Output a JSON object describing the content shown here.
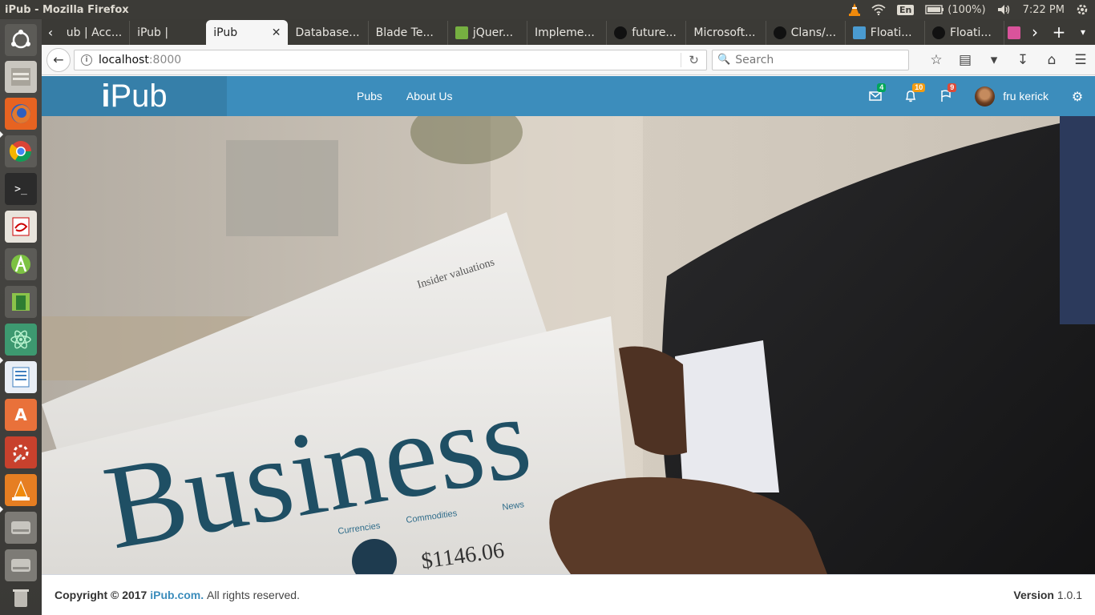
{
  "os": {
    "window_title": "iPub - Mozilla Firefox",
    "battery": "(100%)",
    "clock": "7:22 PM",
    "keyboard_layout": "En"
  },
  "browser": {
    "tabs": [
      {
        "label": "ub | Acc...",
        "icon_color": ""
      },
      {
        "label": "iPub |",
        "icon_color": ""
      },
      {
        "label": "iPub",
        "icon_color": "",
        "active": true
      },
      {
        "label": "Database...",
        "icon_color": ""
      },
      {
        "label": "Blade Te...",
        "icon_color": ""
      },
      {
        "label": "jQuer...",
        "icon_color": "#76b041"
      },
      {
        "label": "Impleme...",
        "icon_color": ""
      },
      {
        "label": "future...",
        "icon_color": "#222222"
      },
      {
        "label": "Microsoft...",
        "icon_color": ""
      },
      {
        "label": "Clans/...",
        "icon_color": "#222222"
      },
      {
        "label": "Floati...",
        "icon_color": "#4a9bd1"
      },
      {
        "label": "Floati...",
        "icon_color": "#222222"
      }
    ],
    "url_host": "localhost",
    "url_port": ":8000",
    "search_placeholder": "Search"
  },
  "header": {
    "brand_prefix": "i",
    "brand_suffix": "Pub",
    "nav": [
      "Pubs",
      "About Us"
    ],
    "badges": {
      "messages": "4",
      "notifications": "10",
      "tasks": "9"
    },
    "badge_colors": {
      "messages": "#00a65a",
      "notifications": "#f39c12",
      "tasks": "#dd4b39"
    },
    "user_name": "fru kerick"
  },
  "hero": {
    "headline": "Business",
    "price": "$1146.06",
    "section_currencies": "Currencies",
    "section_commodities": "Commodities",
    "section_news": "News"
  },
  "footer": {
    "copyright_prefix": "Copyright © 2017",
    "site_link": "iPub.com.",
    "rights": "All rights reserved.",
    "version_label": "Version",
    "version_number": "1.0.1"
  }
}
